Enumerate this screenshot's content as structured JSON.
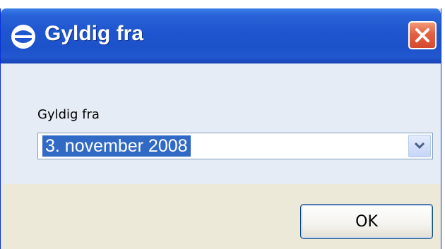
{
  "window": {
    "title": "Gyldig fra",
    "icon": "app-logo-icon",
    "close_icon": "close-icon"
  },
  "form": {
    "label": "Gyldig fra",
    "selected_value": "3. november 2008",
    "dropdown_icon": "chevron-down-icon"
  },
  "footer": {
    "ok_label": "OK"
  },
  "colors": {
    "titlebar": "#1f56cf",
    "close_button": "#e26043",
    "selection": "#316ac5",
    "content_bg": "#e6ecf5",
    "footer_bg": "#ece9d8"
  }
}
